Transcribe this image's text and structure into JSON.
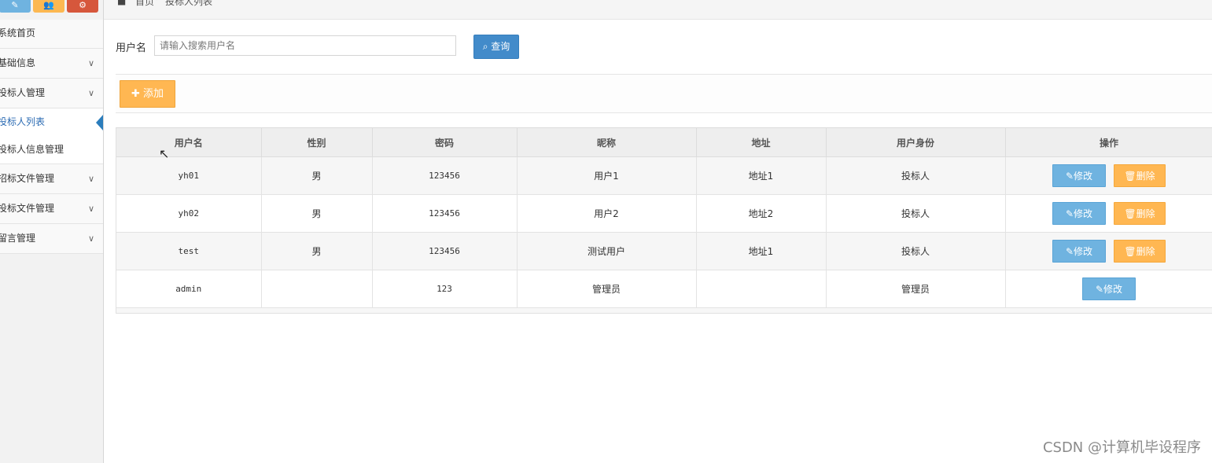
{
  "sidebar": {
    "shortcut_icons": [
      "pencil-icon",
      "users-icon",
      "cogs-icon"
    ],
    "items": [
      {
        "label": "系统首页",
        "expandable": false
      },
      {
        "label": "基础信息",
        "expandable": true
      },
      {
        "label": "投标人管理",
        "expandable": true
      },
      {
        "label": "招标文件管理",
        "expandable": true
      },
      {
        "label": "投标文件管理",
        "expandable": true
      },
      {
        "label": "留言管理",
        "expandable": true
      }
    ],
    "sub_items": [
      {
        "label": "投标人列表",
        "active": true
      },
      {
        "label": "投标人信息管理",
        "active": false
      }
    ]
  },
  "breadcrumb": {
    "home": "首页",
    "current": "投标人列表"
  },
  "search": {
    "label": "用户名",
    "placeholder": "请输入搜索用户名",
    "button_label": "查询"
  },
  "toolbar": {
    "add_label": "添加"
  },
  "table": {
    "headers": [
      "用户名",
      "性别",
      "密码",
      "昵称",
      "地址",
      "用户身份",
      "操作"
    ],
    "rows": [
      {
        "username": "yh01",
        "gender": "男",
        "password": "123456",
        "nickname": "用户1",
        "address": "地址1",
        "role": "投标人",
        "edit": "修改",
        "delete": "删除"
      },
      {
        "username": "yh02",
        "gender": "男",
        "password": "123456",
        "nickname": "用户2",
        "address": "地址2",
        "role": "投标人",
        "edit": "修改",
        "delete": "删除"
      },
      {
        "username": "test",
        "gender": "男",
        "password": "123456",
        "nickname": "测试用户",
        "address": "地址1",
        "role": "投标人",
        "edit": "修改",
        "delete": "删除"
      },
      {
        "username": "admin",
        "gender": "",
        "password": "123",
        "nickname": "管理员",
        "address": "",
        "role": "管理员",
        "edit": "修改",
        "delete": null
      }
    ]
  },
  "watermark": "CSDN @计算机毕设程序",
  "colors": {
    "primary": "#428bca",
    "info": "#6fb3e0",
    "warning": "#ffb752",
    "danger": "#d6573c"
  }
}
